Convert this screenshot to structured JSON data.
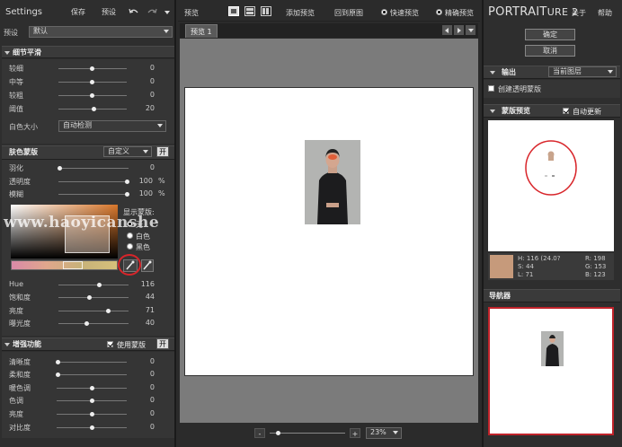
{
  "left": {
    "title": "Settings",
    "save_label": "保存",
    "presets_label": "预设",
    "undo_icon": "undo-icon",
    "redo_icon": "redo-icon",
    "preset_label": "预设",
    "preset_value": "默认",
    "detail": {
      "header": "细节平滑",
      "sliders": [
        {
          "label": "较细",
          "value": "0"
        },
        {
          "label": "中等",
          "value": "0"
        },
        {
          "label": "较粗",
          "value": "0"
        },
        {
          "label": "阈值",
          "value": "20"
        }
      ],
      "size_label": "白色大小",
      "size_value": "自动检测"
    },
    "mask": {
      "header": "肤色蒙版",
      "mode": "自定义",
      "button": "开",
      "sliders": [
        {
          "label": "羽化",
          "value": "0",
          "unit": ""
        },
        {
          "label": "透明度",
          "value": "100",
          "unit": "%"
        },
        {
          "label": "模糊",
          "value": "100",
          "unit": "%"
        }
      ],
      "show_label": "显示蒙版:",
      "radios": [
        "无",
        "白色",
        "黑色"
      ],
      "watermark": "www.haoyicanshe",
      "hsl": [
        {
          "label": "Hue",
          "value": "116"
        },
        {
          "label": "饱和度",
          "value": "44"
        },
        {
          "label": "亮度",
          "value": "71"
        },
        {
          "label": "曝光度",
          "value": "40"
        }
      ]
    },
    "enhance": {
      "header": "增强功能",
      "use_mask": "使用蒙版",
      "button": "开",
      "sliders": [
        {
          "label": "清晰度",
          "value": "0"
        },
        {
          "label": "柔和度",
          "value": "0"
        },
        {
          "label": "暖色调",
          "value": "0"
        },
        {
          "label": "色调",
          "value": "0"
        },
        {
          "label": "亮度",
          "value": "0"
        },
        {
          "label": "对比度",
          "value": "0"
        }
      ]
    }
  },
  "center": {
    "preview_label": "预览",
    "add_preview": "添加预览",
    "restore": "回到原图",
    "quick_preview": "快速预览",
    "precise_preview": "精确预览",
    "tab": "预览 1",
    "zoom": "23%",
    "minus": "-",
    "plus": "+"
  },
  "right": {
    "logo_a": "PORTRAIT",
    "logo_b": "URE 2",
    "about": "关于",
    "help": "帮助",
    "ok": "确定",
    "cancel": "取消",
    "output_header": "输出",
    "output_value": "当前图层",
    "new_layer": "创建透明蒙版",
    "mask_preview_header": "蒙版预览",
    "auto_update": "自动更新",
    "info": {
      "h": "H: 116 (24.0?",
      "s": "S: 44",
      "l": "L: 71",
      "r": "R: 198",
      "g": "G: 153",
      "b": "B: 123"
    },
    "swatch_color": "#c69a7b",
    "navigator": "导航器"
  }
}
